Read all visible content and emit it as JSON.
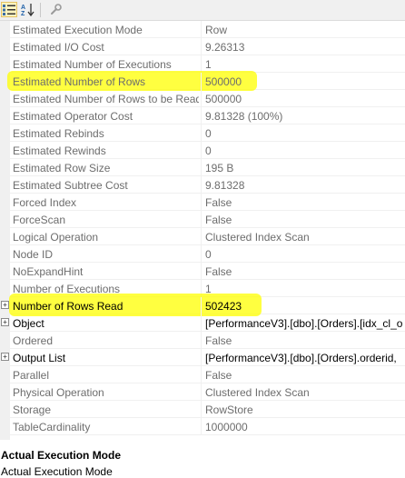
{
  "toolbar": {
    "buttons": [
      {
        "name": "categorized-view-button",
        "icon": "categorized-icon",
        "selected": true
      },
      {
        "name": "alphabetical-sort-button",
        "icon": "sort-az-icon",
        "selected": false
      },
      {
        "name": "property-pages-button",
        "icon": "wrench-icon",
        "selected": false
      }
    ],
    "sort_glyph_a": "A",
    "sort_glyph_z": "Z"
  },
  "properties": [
    {
      "name": "Estimated Execution Mode",
      "value": "Row"
    },
    {
      "name": "Estimated I/O Cost",
      "value": "9.26313"
    },
    {
      "name": "Estimated Number of Executions",
      "value": "1"
    },
    {
      "name": "Estimated Number of Rows",
      "value": "500000",
      "highlighted": true
    },
    {
      "name": "Estimated Number of Rows to be Read",
      "value": "500000"
    },
    {
      "name": "Estimated Operator Cost",
      "value": "9.81328 (100%)"
    },
    {
      "name": "Estimated Rebinds",
      "value": "0"
    },
    {
      "name": "Estimated Rewinds",
      "value": "0"
    },
    {
      "name": "Estimated Row Size",
      "value": "195 B"
    },
    {
      "name": "Estimated Subtree Cost",
      "value": "9.81328"
    },
    {
      "name": "Forced Index",
      "value": "False"
    },
    {
      "name": "ForceScan",
      "value": "False"
    },
    {
      "name": "Logical Operation",
      "value": "Clustered Index Scan"
    },
    {
      "name": "Node ID",
      "value": "0"
    },
    {
      "name": "NoExpandHint",
      "value": "False"
    },
    {
      "name": "Number of Executions",
      "value": "1"
    },
    {
      "name": "Number of Rows Read",
      "value": "502423",
      "expandable": true,
      "dark": true,
      "highlighted": true
    },
    {
      "name": "Object",
      "value": "[PerformanceV3].[dbo].[Orders].[idx_cl_o",
      "expandable": true,
      "dark": true
    },
    {
      "name": "Ordered",
      "value": "False"
    },
    {
      "name": "Output List",
      "value": "[PerformanceV3].[dbo].[Orders].orderid,",
      "expandable": true,
      "dark": true
    },
    {
      "name": "Parallel",
      "value": "False"
    },
    {
      "name": "Physical Operation",
      "value": "Clustered Index Scan"
    },
    {
      "name": "Storage",
      "value": "RowStore"
    },
    {
      "name": "TableCardinality",
      "value": "1000000"
    }
  ],
  "description": {
    "title": "Actual Execution Mode",
    "text": "Actual Execution Mode"
  },
  "colors": {
    "highlight": "#ffff00",
    "muted_text": "#6d6d6d",
    "selected_button": "#fdf4bf"
  }
}
